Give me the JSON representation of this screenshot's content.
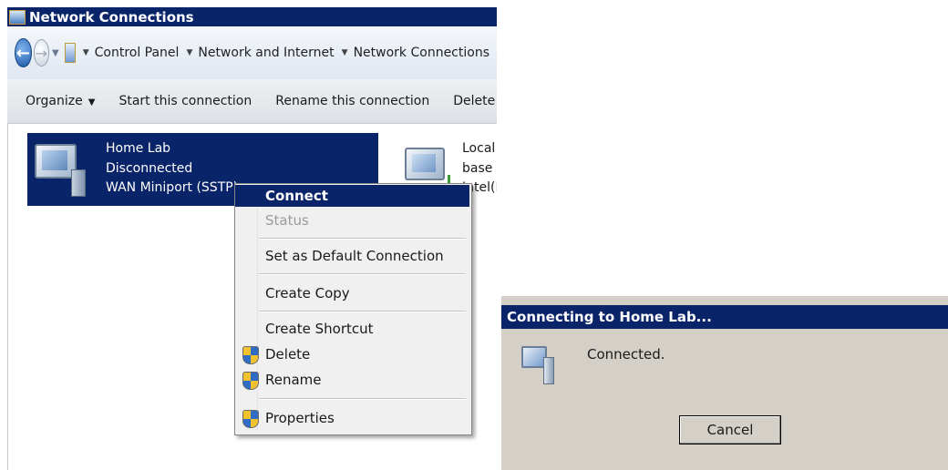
{
  "window": {
    "title": "Network Connections",
    "breadcrumb": [
      "Control Panel",
      "Network and Internet",
      "Network Connections"
    ],
    "commands": [
      "Organize",
      "Start this connection",
      "Rename this connection",
      "Delete this connection"
    ]
  },
  "connections": [
    {
      "name": "Home Lab",
      "status": "Disconnected",
      "device": "WAN Miniport (SSTP)",
      "selected": true
    },
    {
      "name": "Local Area Connection",
      "status": "base",
      "device": "Intel(R)",
      "selected": false
    }
  ],
  "context_menu": {
    "items": [
      {
        "label": "Connect",
        "highlighted": true,
        "default": true
      },
      {
        "label": "Status",
        "disabled": true
      },
      {
        "label": "Set as Default Connection"
      },
      {
        "label": "Create Copy"
      },
      {
        "label": "Create Shortcut"
      },
      {
        "label": "Delete",
        "icon": "uac-shield-icon"
      },
      {
        "label": "Rename",
        "icon": "uac-shield-icon"
      },
      {
        "label": "Properties",
        "icon": "uac-shield-icon"
      }
    ]
  },
  "dialog": {
    "title": "Connecting to Home Lab...",
    "message": "Connected.",
    "cancel_label": "Cancel"
  },
  "colors": {
    "titlebar": "#0a246a",
    "selection": "#0a246a",
    "dialog_bg": "#d4d0c8"
  }
}
